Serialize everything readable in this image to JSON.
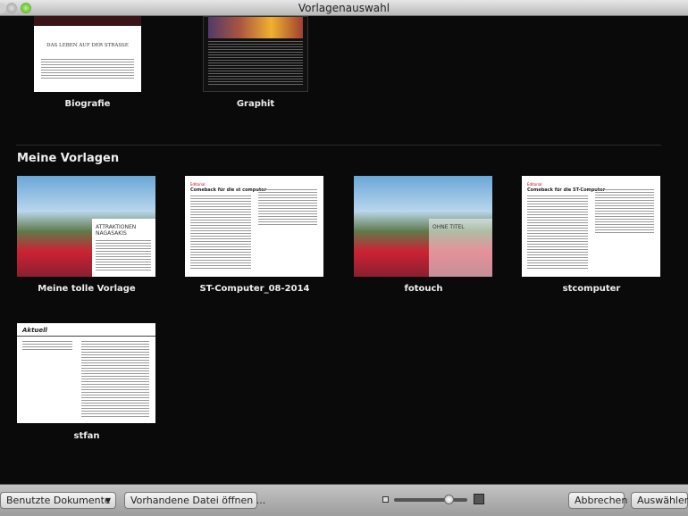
{
  "window": {
    "title": "Vorlagenauswahl"
  },
  "top_templates": [
    {
      "name": "Biografie",
      "heading": "DAS LEBEN AUF DER STRASSE"
    },
    {
      "name": "Graphit"
    }
  ],
  "section": {
    "title": "Meine Vorlagen"
  },
  "my_templates": [
    {
      "name": "Meine tolle Vorlage",
      "heading": "ATTRAKTIONEN NAGASAKIS"
    },
    {
      "name": "ST-Computer_08-2014",
      "heading": "Comeback für die st computer"
    },
    {
      "name": "fotouch",
      "heading": "OHNE TITEL"
    },
    {
      "name": "stcomputer",
      "heading": "Comeback für die ST-Computer"
    },
    {
      "name": "stfan",
      "heading": "Aktuell"
    }
  ],
  "bottom": {
    "recent_label": "Benutzte Dokumente",
    "open_label": "Vorhandene Datei öffnen ...",
    "cancel_label": "Abbrechen",
    "choose_label": "Auswählen",
    "zoom_slider_value": 0.75
  }
}
